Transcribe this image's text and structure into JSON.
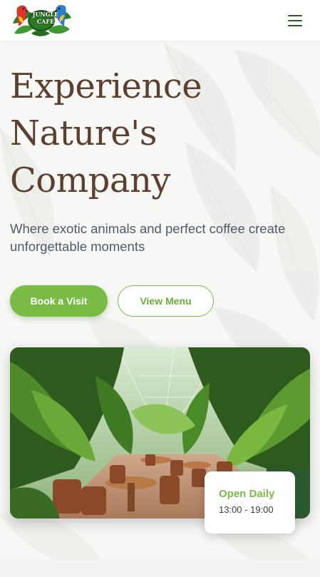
{
  "header": {
    "logo_text_line1": "JUNGLE",
    "logo_text_line2": "CAFÉ"
  },
  "hero": {
    "title_line1": "Experience",
    "title_line2": "Nature's",
    "title_line3": "Company",
    "subtitle": "Where exotic animals and perfect coffee create unforgettable moments",
    "primary_button": "Book a Visit",
    "secondary_button": "View Menu"
  },
  "hours": {
    "title": "Open Daily",
    "time": "13:00 - 19:00"
  },
  "icons": {
    "menu": "hamburger-menu-icon",
    "logo": "parrot-leaves-logo"
  },
  "colors": {
    "accent_green": "#79bb45",
    "title_brown": "#5b4030",
    "menu_icon": "#2e5a2a"
  }
}
